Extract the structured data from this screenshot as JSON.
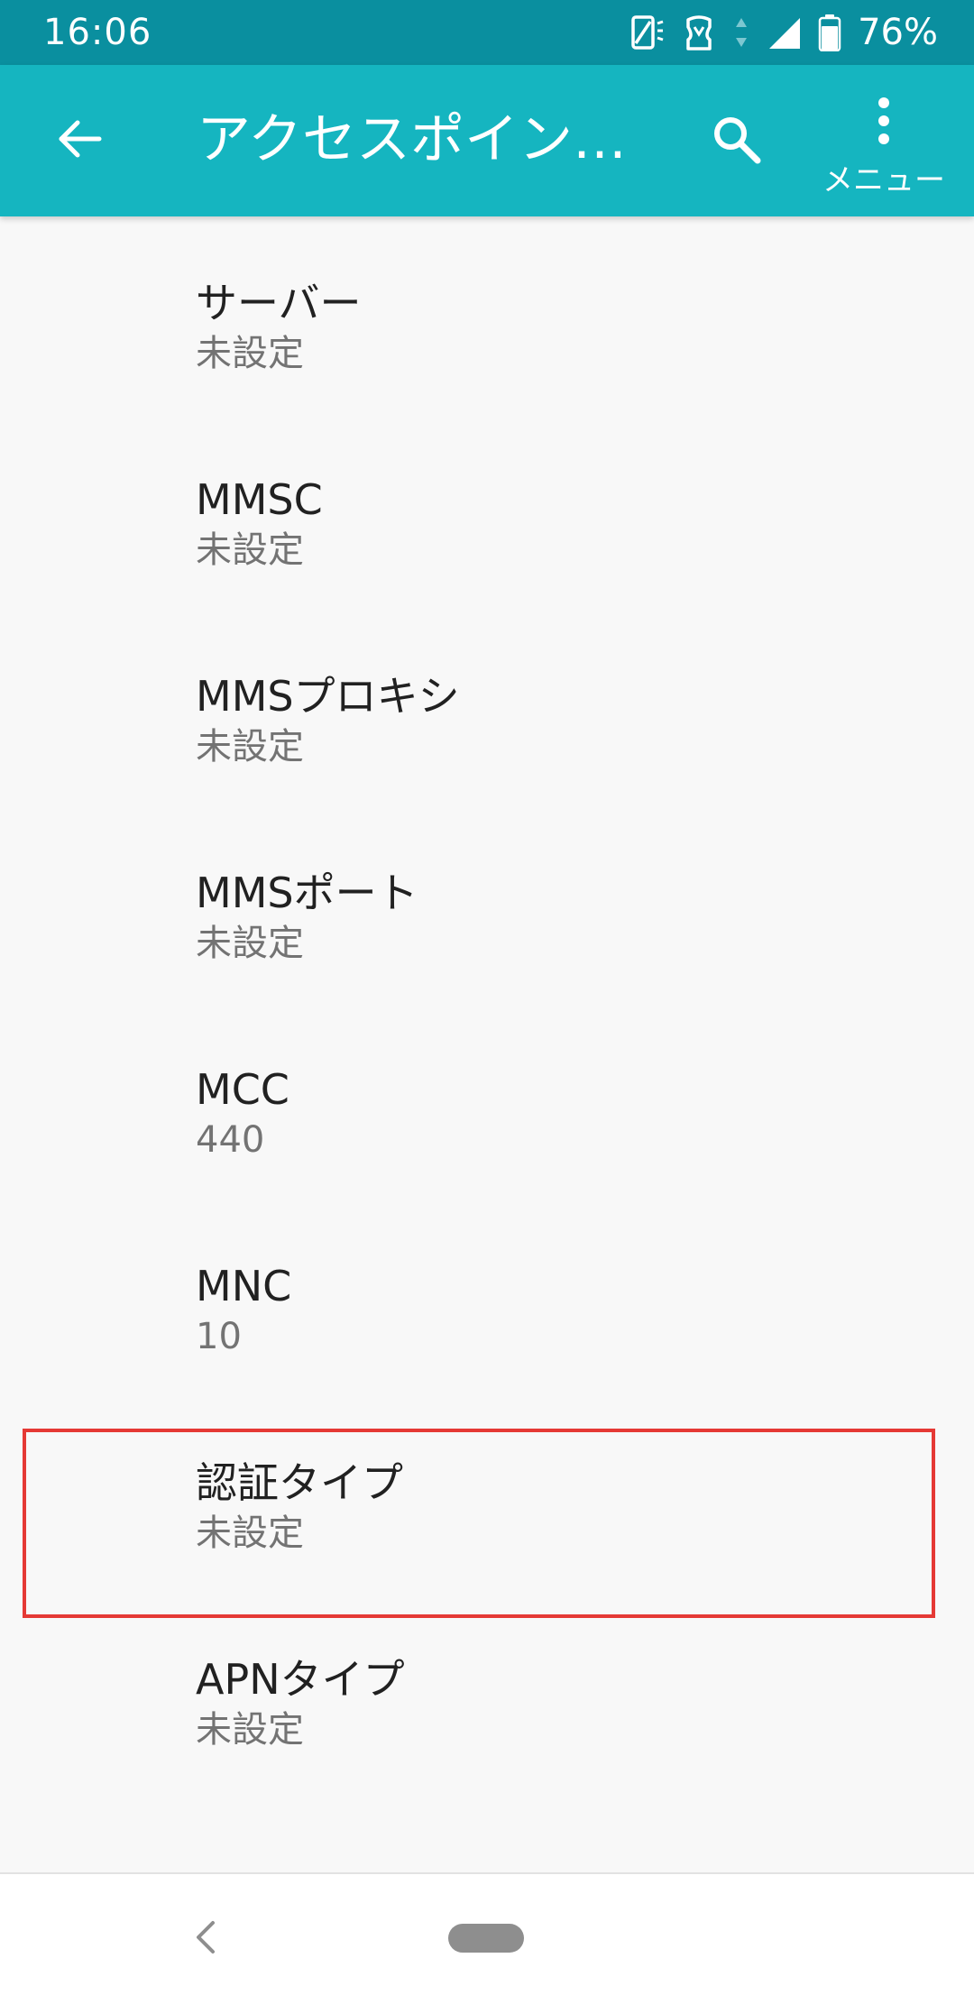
{
  "status_bar": {
    "time": "16:06",
    "battery_percent": "76%",
    "icons": [
      "vibrate-icon",
      "battery-saver-icon",
      "data-arrows-icon",
      "signal-icon",
      "battery-icon"
    ],
    "battery_level": 0.76,
    "color": "#0a8f9f"
  },
  "app_bar": {
    "title": "アクセスポイン…",
    "back_icon": "arrow-back-icon",
    "search_icon": "search-icon",
    "menu_icon": "more-vert-icon",
    "menu_label": "メニュー",
    "color": "#15b5c0"
  },
  "settings": {
    "items": [
      {
        "title": "サーバー",
        "value": "未設定"
      },
      {
        "title": "MMSC",
        "value": "未設定"
      },
      {
        "title": "MMSプロキシ",
        "value": "未設定"
      },
      {
        "title": "MMSポート",
        "value": "未設定"
      },
      {
        "title": "MCC",
        "value": "440"
      },
      {
        "title": "MNC",
        "value": "10"
      },
      {
        "title": "認証タイプ",
        "value": "未設定",
        "highlighted": true
      },
      {
        "title": "APNタイプ",
        "value": "未設定"
      }
    ]
  },
  "highlight": {
    "color": "#e53935"
  },
  "nav_bar": {
    "back_icon": "nav-back-icon",
    "home_icon": "home-pill-icon"
  }
}
